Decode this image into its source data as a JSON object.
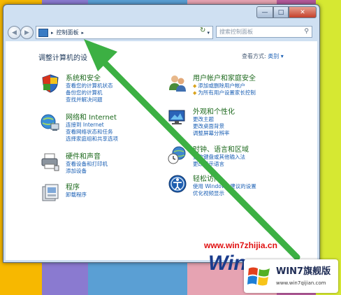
{
  "window": {
    "caption": {
      "minimize": "—",
      "maximize": "□",
      "close": "✕"
    }
  },
  "navbar": {
    "back": "◀",
    "forward": "▶",
    "address_arrow_left": "▸",
    "address": "控制面板",
    "address_arrow_right": "▸",
    "dropdown": "▾",
    "refresh": "↻",
    "search_placeholder": "搜索控制面板",
    "search_icon": "⚲"
  },
  "content": {
    "heading": "调整计算机的设",
    "view_by_label": "查看方式:",
    "view_by_value": "类别 ▾",
    "categories": [
      {
        "icon": "shield-icon",
        "title": "系统和安全",
        "links": [
          "查看您的计算机状态",
          "备份您的计算机",
          "查找并解决问题"
        ]
      },
      {
        "icon": "network-icon",
        "title": "网络和 Internet",
        "links": [
          "查看网络状态和任务",
          "选择家庭组和共享选项"
        ]
      },
      {
        "icon": "printer-icon",
        "title": "硬件和声音",
        "links": [
          "查看设备和打印机",
          "添加设备"
        ]
      },
      {
        "icon": "programs-icon",
        "title": "程序",
        "links": [
          "卸载程序"
        ]
      },
      {
        "icon": "users-icon",
        "title": "用户帐户和家庭安全",
        "links": [
          "添加或删除用户帐户",
          "为所有用户设置家长控制"
        ]
      },
      {
        "icon": "appearance-icon",
        "title": "外观和个性化",
        "links": [
          "更改主题",
          "更改桌面背景",
          "调整屏幕分辨率"
        ]
      },
      {
        "icon": "clock-icon",
        "title": "时钟、语言和区域",
        "links": [
          "更改键盘或其他输入法",
          "更改显示语言"
        ]
      },
      {
        "icon": "ease-icon",
        "title": "轻松访问",
        "links": [
          "使用 Windows 建议的设置",
          "优化视频显示"
        ]
      }
    ],
    "network_extra": "连接到 Internet"
  },
  "watermark": {
    "url": "www.win7zhijia.cn",
    "win": "Win",
    "brand": "WIN7旗舰版",
    "brand_url": "www.win7qijian.com"
  },
  "colors": {
    "arrow": "#3cb043",
    "link": "#1a5fb4",
    "category_title": "#1e6a1e"
  }
}
